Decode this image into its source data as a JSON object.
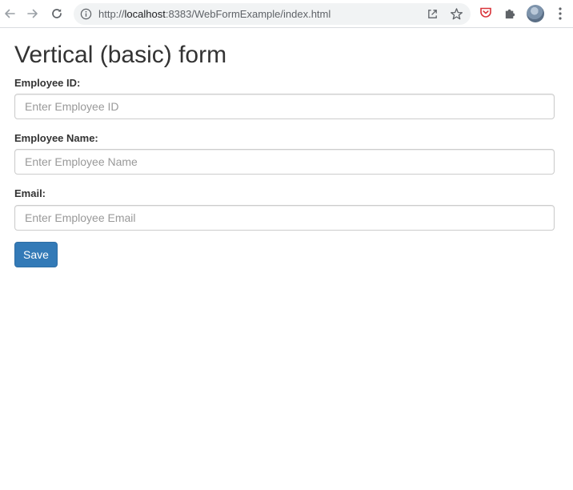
{
  "browser": {
    "url_scheme": "http://",
    "url_host": "localhost",
    "url_rest": ":8383/WebFormExample/index.html",
    "icons": {
      "back": "back-arrow-icon",
      "forward": "forward-arrow-icon",
      "reload": "reload-icon",
      "site_info": "info-icon",
      "share": "share-icon",
      "bookmark": "star-icon",
      "extension_1": "pocket-extension-icon",
      "extensions": "puzzle-icon",
      "profile": "avatar",
      "menu": "kebab-menu-icon"
    }
  },
  "form": {
    "title": "Vertical (basic) form",
    "fields": [
      {
        "label": "Employee ID:",
        "placeholder": "Enter Employee ID",
        "value": ""
      },
      {
        "label": "Employee Name:",
        "placeholder": "Enter Employee Name",
        "value": ""
      },
      {
        "label": "Email:",
        "placeholder": "Enter Employee Email",
        "value": ""
      }
    ],
    "save_label": "Save"
  },
  "colors": {
    "primary_button": "#337ab7",
    "text": "#333333",
    "input_border": "#cccccc",
    "placeholder": "#999999"
  }
}
